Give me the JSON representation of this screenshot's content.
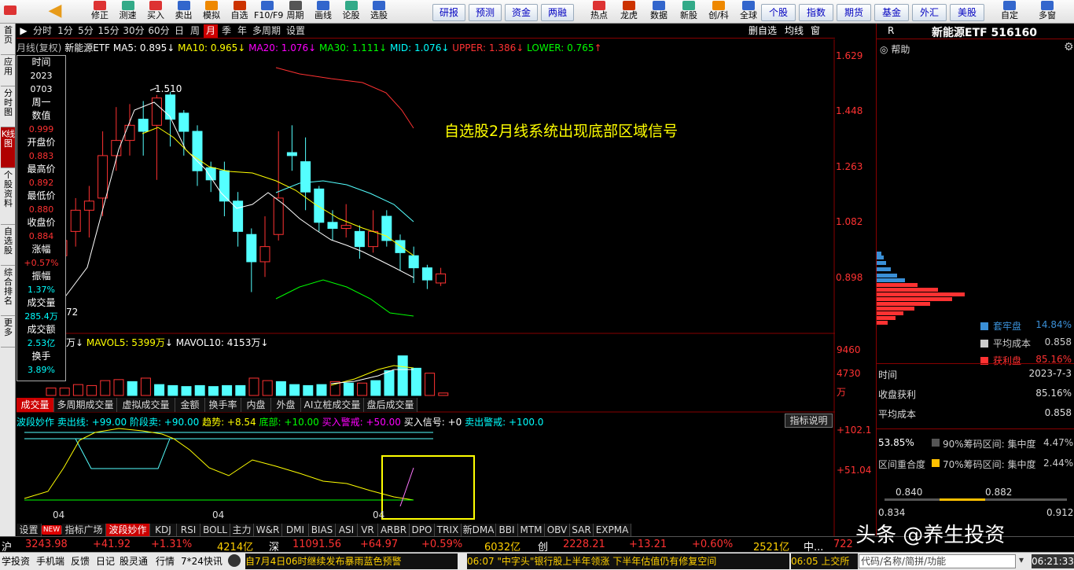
{
  "toolbar": {
    "items": [
      {
        "label": "修正",
        "icon": "edit-icon"
      },
      {
        "label": "测速",
        "icon": "speed-icon"
      },
      {
        "label": "买入",
        "icon": "buy-icon"
      },
      {
        "label": "卖出",
        "icon": "sell-icon"
      },
      {
        "label": "模拟",
        "icon": "simulate-icon"
      },
      {
        "label": "自选",
        "icon": "watchlist-icon"
      },
      {
        "label": "F10/F9",
        "icon": "f10-icon"
      },
      {
        "label": "周期",
        "icon": "period-icon"
      },
      {
        "label": "画线",
        "icon": "draw-icon"
      },
      {
        "label": "论股",
        "icon": "forum-icon"
      },
      {
        "label": "选股",
        "icon": "screen-icon"
      }
    ],
    "buttons": [
      "研报",
      "预测",
      "资金",
      "两融"
    ],
    "items2": [
      {
        "label": "热点",
        "icon": "hot-icon"
      },
      {
        "label": "龙虎",
        "icon": "dragon-icon"
      },
      {
        "label": "数据",
        "icon": "data-icon"
      },
      {
        "label": "新股",
        "icon": "ipo-icon"
      },
      {
        "label": "创/科",
        "icon": "growth-icon"
      },
      {
        "label": "全球",
        "icon": "globe-icon"
      }
    ],
    "buttons2": [
      "个股",
      "指数",
      "期货",
      "基金",
      "外汇",
      "美股"
    ],
    "items3": [
      {
        "label": "自定",
        "icon": "custom-icon"
      },
      {
        "label": "多窗",
        "icon": "multiwindow-icon"
      }
    ]
  },
  "leftnav": [
    "首页",
    "应用",
    "分时图",
    "K线图",
    "个股资料",
    "自选股",
    "综合排名",
    "更多"
  ],
  "periods": [
    "分时",
    "1分",
    "5分",
    "15分",
    "30分",
    "60分",
    "日",
    "周",
    "月",
    "季",
    "年",
    "多周期",
    "设置"
  ],
  "period_right": [
    "删自选",
    "均线",
    "窗"
  ],
  "chart_info": {
    "left": "月线(复权)",
    "name": "新能源ETF",
    "ma5": "MA5: 0.895",
    "ma10": "MA10: 0.965",
    "ma20": "MA20: 1.076",
    "ma30": "MA30: 1.111",
    "mid": "MID: 1.076",
    "upper": "UPPER: 1.386",
    "lower": "LOWER: 0.765",
    "peak_label": "1.510",
    "low_label": "72",
    "annotation": "自选股2月线系统出现底部区域信号"
  },
  "price_axis": [
    "1.629",
    "1.448",
    "1.263",
    "1.082",
    "0.898"
  ],
  "datawin": [
    {
      "k": "时间",
      "v": "2023",
      "v2": "0703",
      "c": "white"
    },
    {
      "k": "周一",
      "v": "",
      "c": "white"
    },
    {
      "k": "数值",
      "v": "0.999",
      "c": "red"
    },
    {
      "k": "开盘价",
      "v": "0.883",
      "c": "red"
    },
    {
      "k": "最高价",
      "v": "0.892",
      "c": "red"
    },
    {
      "k": "最低价",
      "v": "0.880",
      "c": "red"
    },
    {
      "k": "收盘价",
      "v": "0.884",
      "c": "red"
    },
    {
      "k": "涨幅",
      "v": "+0.57%",
      "c": "red"
    },
    {
      "k": "振幅",
      "v": "1.37%",
      "c": "cyan"
    },
    {
      "k": "成交量",
      "v": "285.4万",
      "c": "cyan"
    },
    {
      "k": "成交额",
      "v": "2.53亿",
      "c": "cyan"
    },
    {
      "k": "换手",
      "v": "3.89%",
      "c": "cyan"
    }
  ],
  "vol_info": {
    "prefix": "万",
    "mavol5": "MAVOL5: 5399万",
    "mavol10": "MAVOL10: 4153万"
  },
  "vol_axis": [
    "9460",
    "4730",
    "万"
  ],
  "subtabs": [
    "成交量",
    "多周期成交量",
    "虚拟成交量",
    "金额",
    "换手率",
    "内盘",
    "外盘",
    "AI立桩成交量",
    "盘后成交量"
  ],
  "ind_info": {
    "name": "波段妙作",
    "sell_line": "卖出线: +99.00",
    "stage_sell": "阶段卖: +90.00",
    "trend": "趋势: +8.54",
    "bottom": "底部: +10.00",
    "buy_alert": "买入警戒: +50.00",
    "buy_signal": "买入信号: +0",
    "sell_alert": "卖出警戒: +100.0",
    "explain": "指标说明"
  },
  "ind_axis": [
    "+102.1",
    "+51.04"
  ],
  "x_labels": [
    "04",
    "04",
    "04"
  ],
  "bottabs": [
    "设置",
    "NEW",
    "指标广场",
    "波段妙作",
    "KDJ",
    "RSI",
    "BOLL",
    "主力",
    "W&R",
    "DMI",
    "BIAS",
    "ASI",
    "VR",
    "ARBR",
    "DPO",
    "TRIX",
    "新DMA",
    "BBI",
    "MTM",
    "OBV",
    "SAR",
    "EXPMA"
  ],
  "right": {
    "r": "R",
    "title": "新能源ETF 516160",
    "help": "帮助",
    "legend": [
      {
        "label": "套牢盘",
        "value": "14.84%",
        "color": "#3a8fd6"
      },
      {
        "label": "平均成本",
        "value": "0.858",
        "color": "#cccccc"
      },
      {
        "label": "获利盘",
        "value": "85.16%",
        "color": "#ff3232"
      }
    ],
    "rows": [
      {
        "k": "时间",
        "v": "2023-7-3"
      },
      {
        "k": "收盘获利",
        "v": "85.16%"
      },
      {
        "k": "平均成本",
        "v": "0.858"
      }
    ],
    "conc1": {
      "pct": "53.85%",
      "label": "90%筹码区间: 集中度",
      "val": "4.47%"
    },
    "conc2": {
      "k": "区间重合度",
      "label": "70%筹码区间: 集中度",
      "val": "2.44%"
    },
    "range_top": [
      "0.840",
      "0.882"
    ],
    "range_bot": [
      "0.834",
      "0.912"
    ]
  },
  "status": [
    {
      "name": "沪",
      "price": "3243.98",
      "chg": "+41.92",
      "pct": "+1.31%",
      "amt": "4214亿"
    },
    {
      "name": "深",
      "price": "11091.56",
      "chg": "+64.97",
      "pct": "+0.59%",
      "amt": "6032亿"
    },
    {
      "name": "创",
      "price": "2228.21",
      "chg": "+13.21",
      "pct": "+0.60%",
      "amt": "2521亿"
    },
    {
      "name": "中...",
      "price": "722",
      "chg": "",
      "pct": "",
      "amt": ""
    }
  ],
  "bottombar": {
    "items": [
      "学投资",
      "手机端",
      "反馈",
      "日记",
      "股灵通",
      "行情",
      "7*24快讯"
    ],
    "news": "自7月4日06时继续发布暴雨蓝色预警",
    "news2": "06:07 \"中字头\"银行股上半年领涨 下半年估值仍有修复空间",
    "news3": "06:05 上交所",
    "search": "代码/名称/简拼/功能",
    "time": "06:21:33"
  },
  "watermark": "头条 @养生投资"
}
